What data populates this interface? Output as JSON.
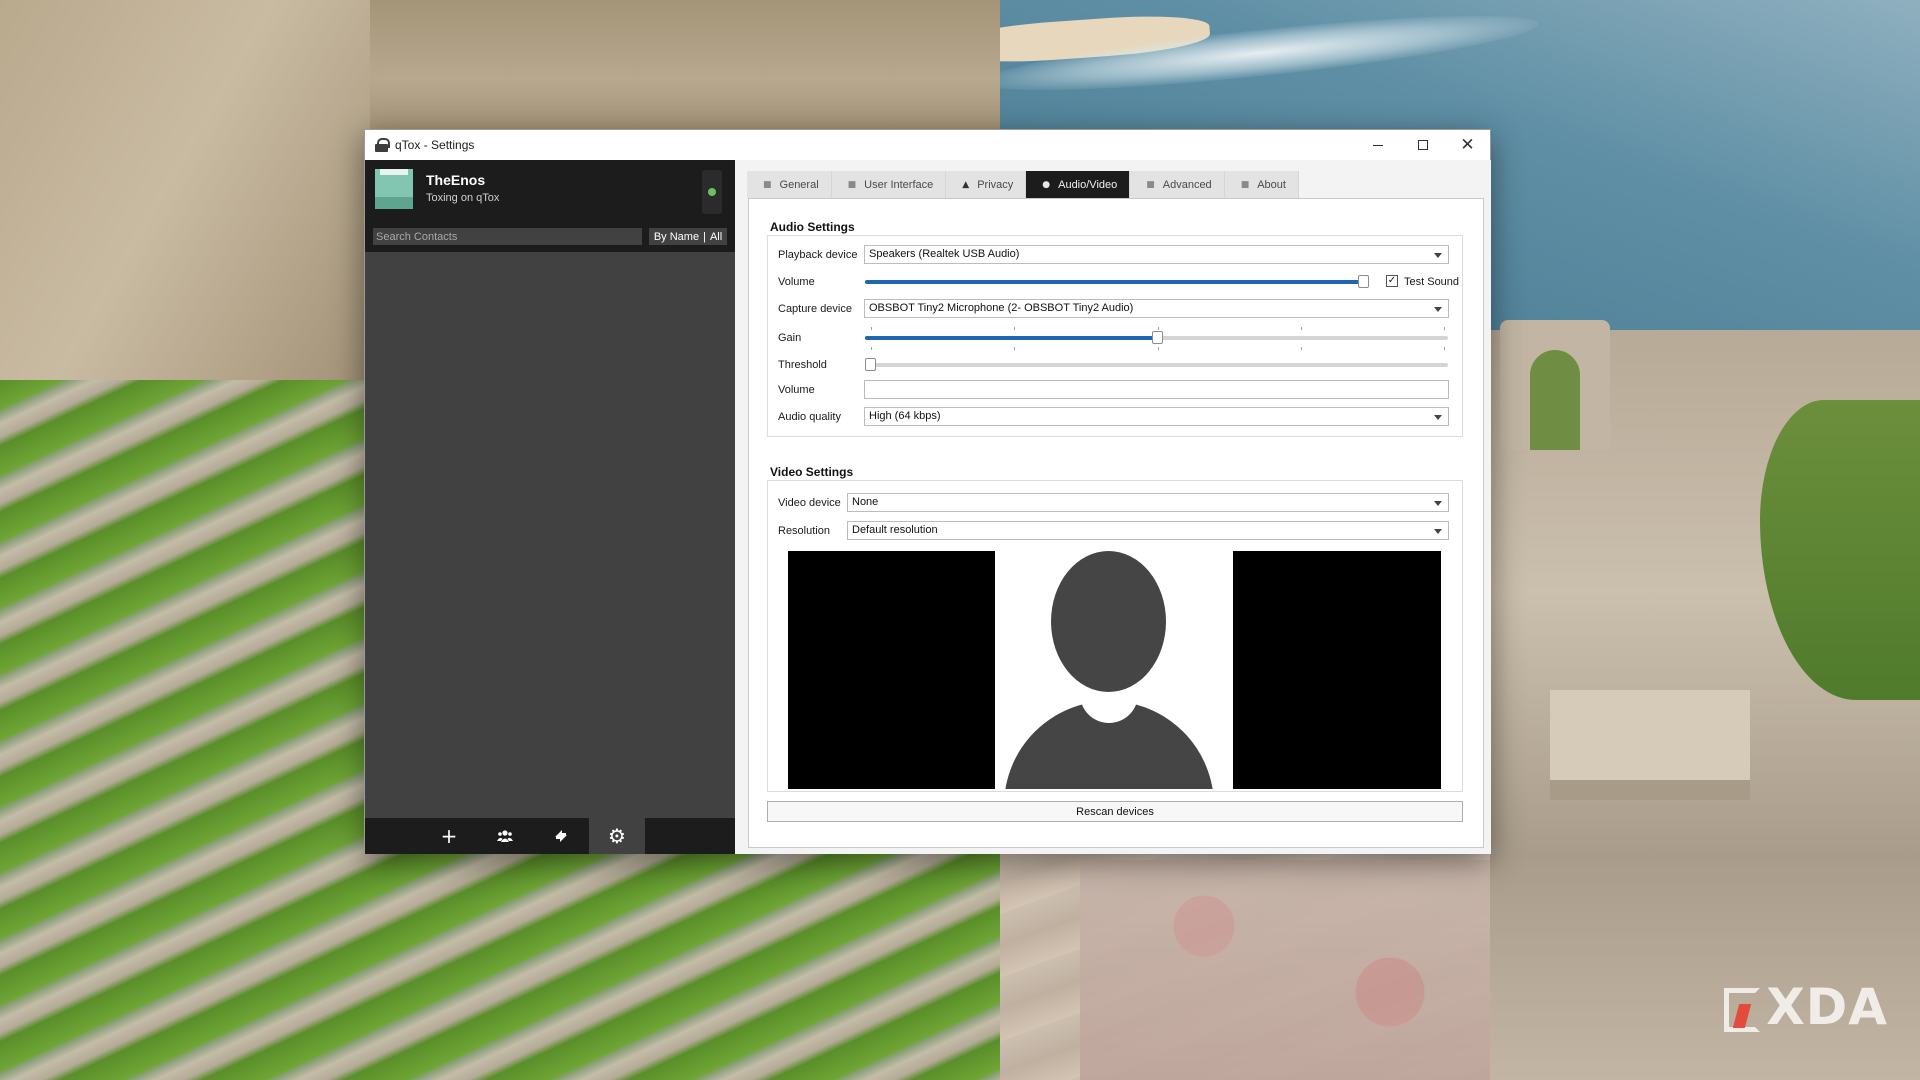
{
  "window": {
    "title": "qTox - Settings",
    "controls": {
      "minimize": "minimize",
      "maximize": "maximize",
      "close": "✕"
    }
  },
  "profile": {
    "name": "TheEnos",
    "status_message": "Toxing on qTox",
    "status_color": "#6bc260"
  },
  "search": {
    "placeholder": "Search Contacts",
    "filter_sort": "By Name",
    "filter_separator": "|",
    "filter_view": "All"
  },
  "bottom_bar": {
    "add_icon": "+",
    "groups_icon": "group-icon",
    "transfers_icon": "transfer-icon",
    "settings_icon": "⚙"
  },
  "tabs": [
    {
      "label": "General",
      "icon": "general-icon",
      "active": false
    },
    {
      "label": "User Interface",
      "icon": "ui-icon",
      "active": false
    },
    {
      "label": "Privacy",
      "icon": "lock-icon",
      "active": false
    },
    {
      "label": "Audio/Video",
      "icon": "audio-video-icon",
      "active": true
    },
    {
      "label": "Advanced",
      "icon": "advanced-icon",
      "active": false
    },
    {
      "label": "About",
      "icon": "about-icon",
      "active": false
    }
  ],
  "audio": {
    "title": "Audio Settings",
    "playback_label": "Playback device",
    "playback_value": "Speakers (Realtek USB Audio)",
    "volume_label": "Volume",
    "volume_level": 1.0,
    "test_sound_label": "Test Sound",
    "test_sound_checked": true,
    "capture_label": "Capture device",
    "capture_value": "OBSBOT Tiny2 Microphone (2- OBSBOT Tiny2 Audio)",
    "gain_label": "Gain",
    "gain_level": 0.5,
    "threshold_label": "Threshold",
    "threshold_level": 0.0,
    "mic_volume_label": "Volume",
    "quality_label": "Audio quality",
    "quality_value": "High (64 kbps)"
  },
  "video": {
    "title": "Video Settings",
    "device_label": "Video device",
    "device_value": "None",
    "resolution_label": "Resolution",
    "resolution_value": "Default resolution"
  },
  "rescan_label": "Rescan devices",
  "checkmark": "✓",
  "watermark": "XDA",
  "colors": {
    "accent": "#1f67b3",
    "dark_panel": "#1c1c1c",
    "contact_bg": "#414141"
  }
}
